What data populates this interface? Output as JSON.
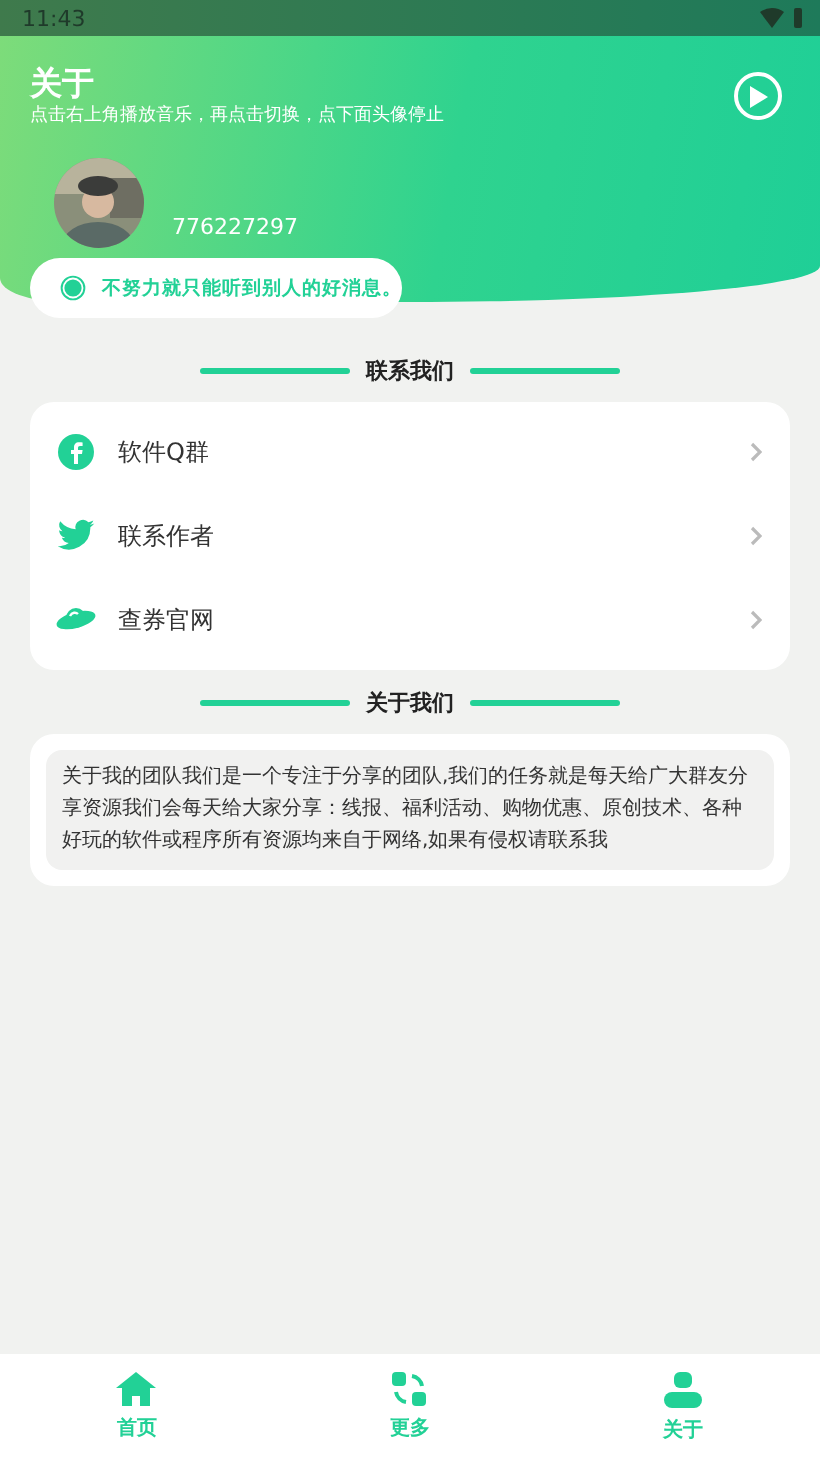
{
  "status_bar": {
    "time": "11:43"
  },
  "header": {
    "title": "关于",
    "subtitle": "点击右上角播放音乐，再点击切换，点下面头像停止",
    "user_id": "776227297",
    "motto": "不努力就只能听到别人的好消息。"
  },
  "contact_section": {
    "heading": "联系我们",
    "items": [
      {
        "kind": "facebook",
        "label": "软件Q群"
      },
      {
        "kind": "bird",
        "label": "联系作者"
      },
      {
        "kind": "planet",
        "label": "查券官网"
      }
    ]
  },
  "about_section": {
    "heading": "关于我们",
    "text": "关于我的团队我们是一个专注于分享的团队,我们的任务就是每天给广大群友分享资源我们会每天给大家分享：线报、福利活动、购物优惠、原创技术、各种好玩的软件或程序所有资源均来自于网络,如果有侵权请联系我"
  },
  "bottom_nav": [
    {
      "kind": "home",
      "label": "首页"
    },
    {
      "kind": "more",
      "label": "更多"
    },
    {
      "kind": "person",
      "label": "关于"
    }
  ]
}
